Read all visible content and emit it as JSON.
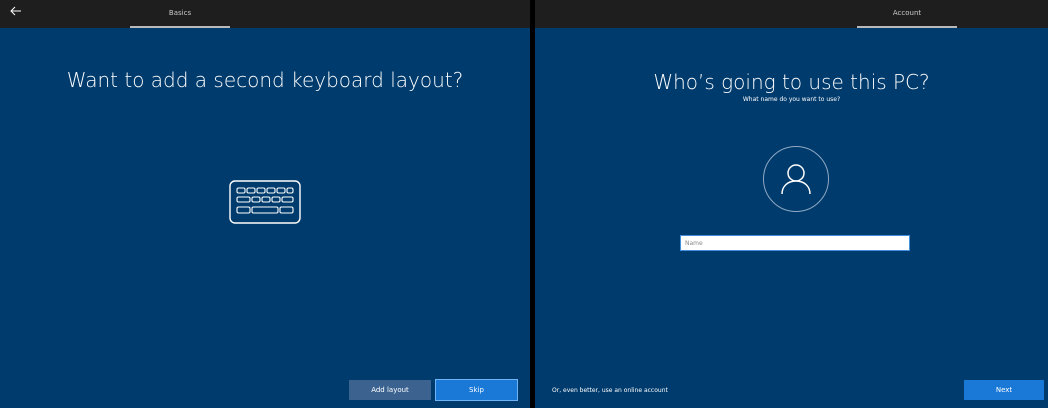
{
  "left_panel": {
    "topbar": {
      "title": "Basics"
    },
    "heading": "Want to add a second keyboard layout?",
    "buttons": {
      "add_layout": "Add layout",
      "skip": "Skip"
    }
  },
  "right_panel": {
    "topbar": {
      "title": "Account"
    },
    "heading": "Who’s going to use this PC?",
    "subheading": "What name do you want to use?",
    "name_input": {
      "placeholder": "Name",
      "value": ""
    },
    "online_account_link": "Or, even better, use an online account",
    "buttons": {
      "next": "Next"
    }
  },
  "colors": {
    "background": "#003b6d",
    "topbar": "#1e1e1e",
    "accent_button": "#1a78d6",
    "secondary_button": "#3c6390"
  },
  "icons": [
    "back-arrow-icon",
    "keyboard-icon",
    "user-icon"
  ]
}
